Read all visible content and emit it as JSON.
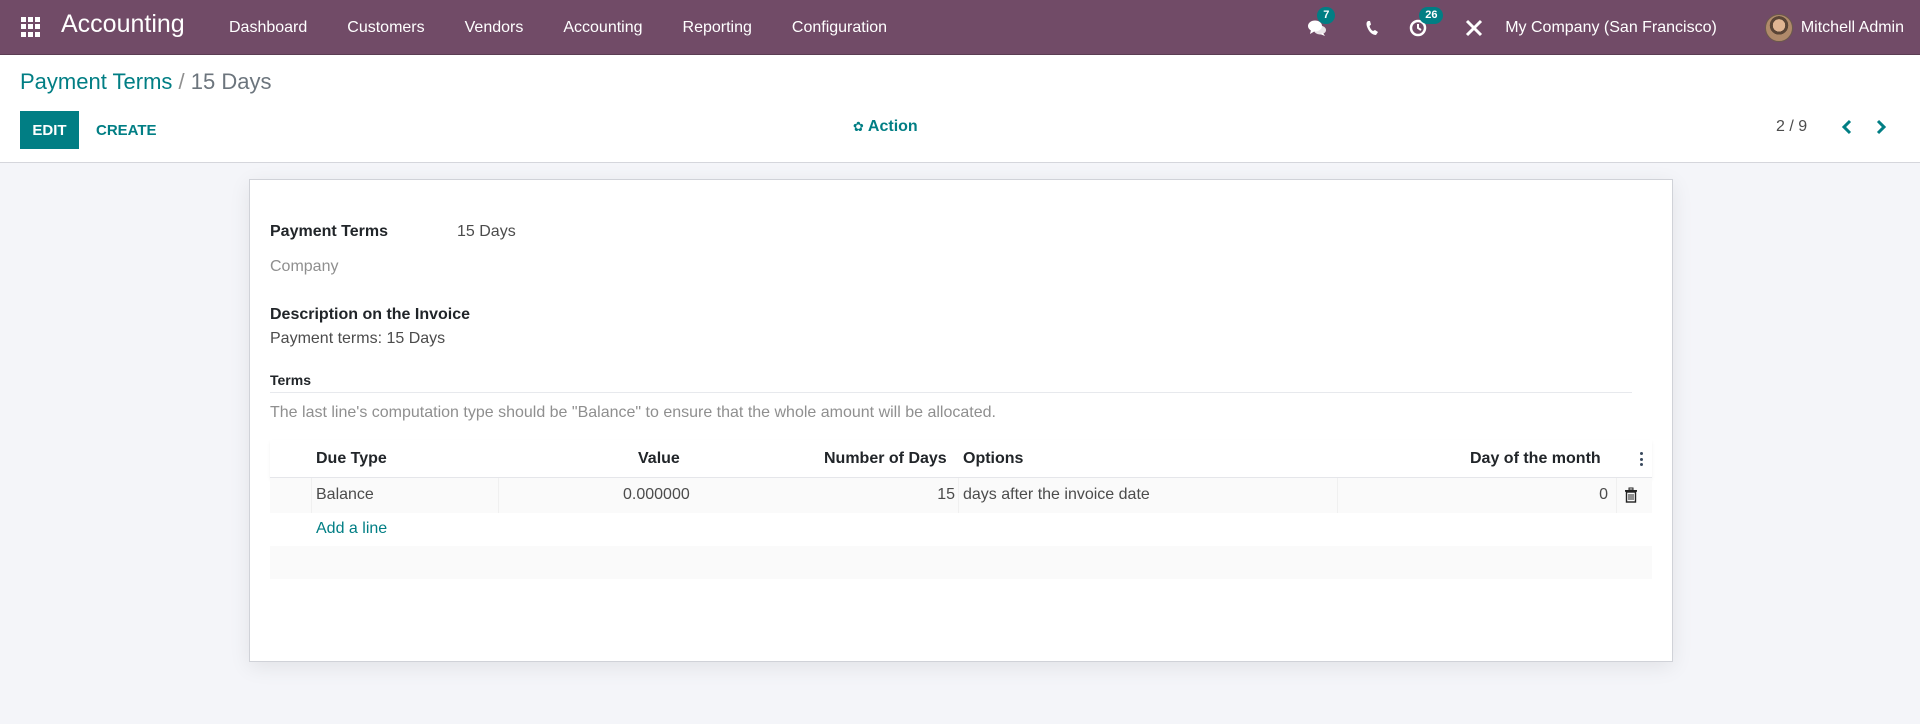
{
  "navbar": {
    "app_name": "Accounting",
    "menu": [
      "Dashboard",
      "Customers",
      "Vendors",
      "Accounting",
      "Reporting",
      "Configuration"
    ],
    "messages_badge": "7",
    "activities_badge": "26",
    "company": "My Company (San Francisco)",
    "user": "Mitchell Admin",
    "bg_color": "#714b67"
  },
  "control_panel": {
    "breadcrumb_parent": "Payment Terms",
    "breadcrumb_sep": " / ",
    "breadcrumb_current": "15 Days",
    "edit_label": "EDIT",
    "create_label": "CREATE",
    "action_label": "Action",
    "pager": "2 / 9",
    "accent_color": "#017e84"
  },
  "form": {
    "payment_terms_label": "Payment Terms",
    "payment_terms_value": "15 Days",
    "company_label": "Company",
    "description_label": "Description on the Invoice",
    "description_value": "Payment terms: 15 Days",
    "terms_section": "Terms",
    "help_text": "The last line's computation type should be \"Balance\" to ensure that the whole amount will be allocated."
  },
  "terms_table": {
    "headers": {
      "due_type": "Due Type",
      "value": "Value",
      "days": "Number of Days",
      "options": "Options",
      "day_of_month": "Day of the month"
    },
    "rows": [
      {
        "due_type": "Balance",
        "value": "0.000000",
        "days": "15",
        "options": "days after the invoice date",
        "day_of_month": "0"
      }
    ],
    "add_line_label": "Add a line"
  }
}
